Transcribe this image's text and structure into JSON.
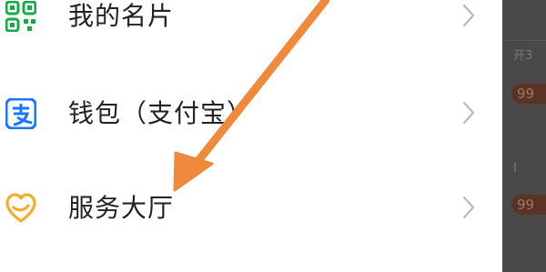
{
  "menu": {
    "items": [
      {
        "label": "我的名片",
        "icon": "qr-code-icon"
      },
      {
        "label": "钱包（支付宝）",
        "icon": "alipay-icon"
      },
      {
        "label": "服务大厅",
        "icon": "service-heart-icon"
      }
    ]
  },
  "background_app": {
    "snippet_top": "开3",
    "pill_1": "99",
    "snippet_mid": "I",
    "pill_2": "99"
  },
  "colors": {
    "qr_icon": "#19a84a",
    "alipay_icon": "#1678ff",
    "service_icon": "#f0ae2a",
    "annotation_arrow": "#ef8a3c",
    "chevron": "#b9b9b9",
    "backdrop": "#4a4848"
  }
}
